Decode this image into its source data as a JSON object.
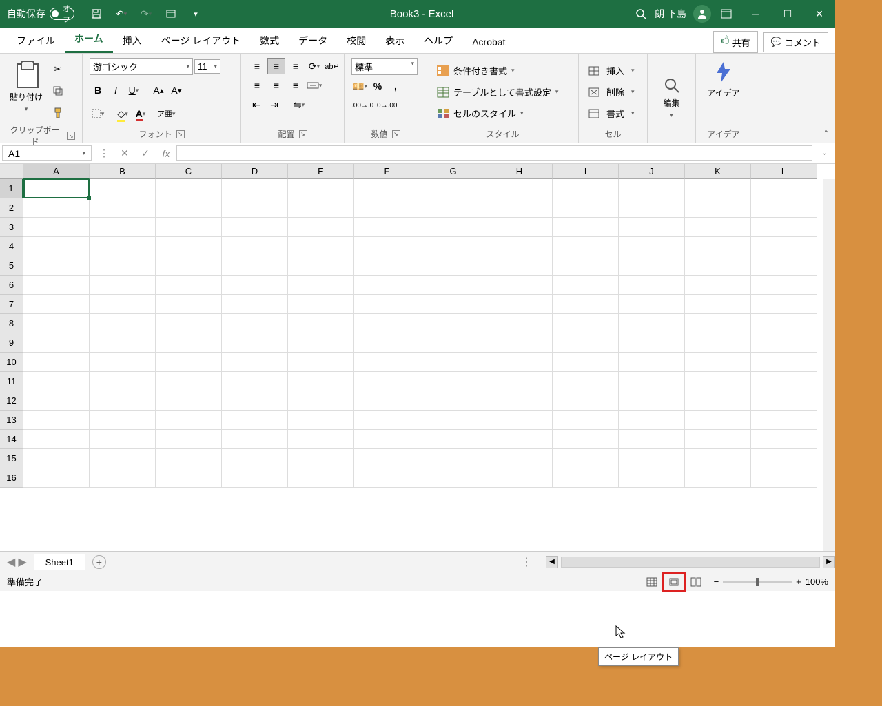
{
  "titlebar": {
    "autosave_label": "自動保存",
    "autosave_state": "オフ",
    "title": "Book3  -  Excel",
    "user_name": "朗 下島"
  },
  "tabs": {
    "file": "ファイル",
    "home": "ホーム",
    "insert": "挿入",
    "page_layout": "ページ レイアウト",
    "formulas": "数式",
    "data": "データ",
    "review": "校閲",
    "view": "表示",
    "help": "ヘルプ",
    "acrobat": "Acrobat",
    "share": "共有",
    "comment": "コメント"
  },
  "ribbon": {
    "clipboard": {
      "paste": "貼り付け",
      "label": "クリップボード"
    },
    "font": {
      "name": "游ゴシック",
      "size": "11",
      "label": "フォント"
    },
    "alignment": {
      "label": "配置"
    },
    "number": {
      "format": "標準",
      "label": "数値"
    },
    "styles": {
      "conditional": "条件付き書式",
      "table": "テーブルとして書式設定",
      "cell_styles": "セルのスタイル",
      "label": "スタイル"
    },
    "cells": {
      "insert": "挿入",
      "delete": "削除",
      "format": "書式",
      "label": "セル"
    },
    "editing": {
      "label": "編集"
    },
    "ideas": {
      "idea": "アイデア",
      "label": "アイデア"
    }
  },
  "formula_bar": {
    "name_box": "A1",
    "fx": "fx"
  },
  "grid": {
    "columns": [
      "A",
      "B",
      "C",
      "D",
      "E",
      "F",
      "G",
      "H",
      "I",
      "J",
      "K",
      "L"
    ],
    "rows": [
      "1",
      "2",
      "3",
      "4",
      "5",
      "6",
      "7",
      "8",
      "9",
      "10",
      "11",
      "12",
      "13",
      "14",
      "15",
      "16"
    ],
    "selected_col": "A",
    "selected_row": "1"
  },
  "sheet_bar": {
    "sheet1": "Sheet1"
  },
  "statusbar": {
    "ready": "準備完了",
    "zoom": "100%",
    "tooltip": "ページ レイアウト"
  }
}
